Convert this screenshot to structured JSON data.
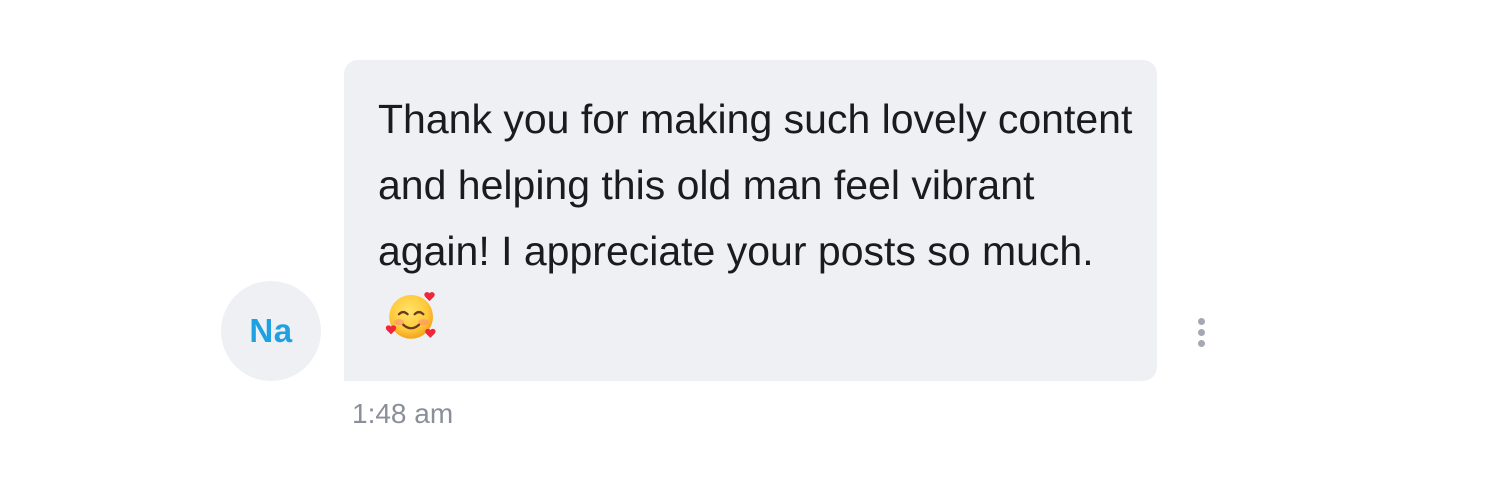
{
  "sender": {
    "initials": "Na",
    "initials_color": "#1da1e2",
    "avatar_bg": "#eff0f3"
  },
  "message": {
    "text": "Thank you for making such lovely content and helping this old man feel vibrant again! I appreciate your posts so much.",
    "emoji": "smiling-face-with-hearts",
    "timestamp": "1:48 am",
    "bubble_color": "#eff0f3"
  },
  "actions": {
    "more_icon": "vertical-ellipsis-icon"
  }
}
